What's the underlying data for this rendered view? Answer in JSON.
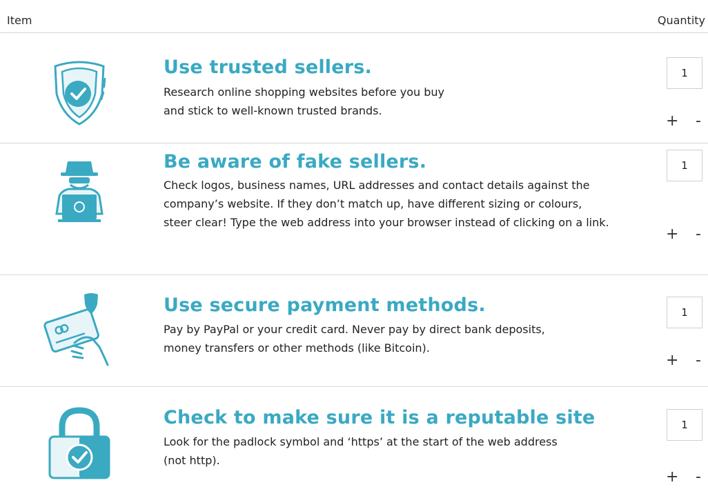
{
  "header": {
    "item_label": "Item",
    "quantity_label": "Quantity"
  },
  "colors": {
    "accent": "#3aa9c2",
    "divider": "#d8d8d8"
  },
  "items": [
    {
      "icon": "shield-check-icon",
      "title": "Use trusted sellers.",
      "lines": [
        "Research online shopping websites before you buy",
        "and stick to well-known trusted brands."
      ],
      "quantity": "1",
      "plus": "+",
      "minus": "-"
    },
    {
      "icon": "hacker-laptop-icon",
      "title": "Be aware of fake sellers.",
      "lines": [
        "Check logos, business names, URL addresses and contact details against the",
        "company’s website. If they don’t match up, have different sizing or colours,",
        "steer clear! Type the web address into your browser instead of clicking on a link."
      ],
      "quantity": "1",
      "plus": "+",
      "minus": "-"
    },
    {
      "icon": "credit-card-shield-icon",
      "title": "Use secure payment methods.",
      "lines": [
        "Pay by PayPal or your credit card. Never pay by direct bank deposits,",
        "money transfers or other methods (like Bitcoin)."
      ],
      "quantity": "1",
      "plus": "+",
      "minus": "-"
    },
    {
      "icon": "padlock-check-icon",
      "title": "Check to make sure it is a reputable site",
      "lines": [
        "Look for the padlock symbol and ‘https’ at the start of the web address",
        "(not http)."
      ],
      "quantity": "1",
      "plus": "+",
      "minus": "-"
    }
  ]
}
